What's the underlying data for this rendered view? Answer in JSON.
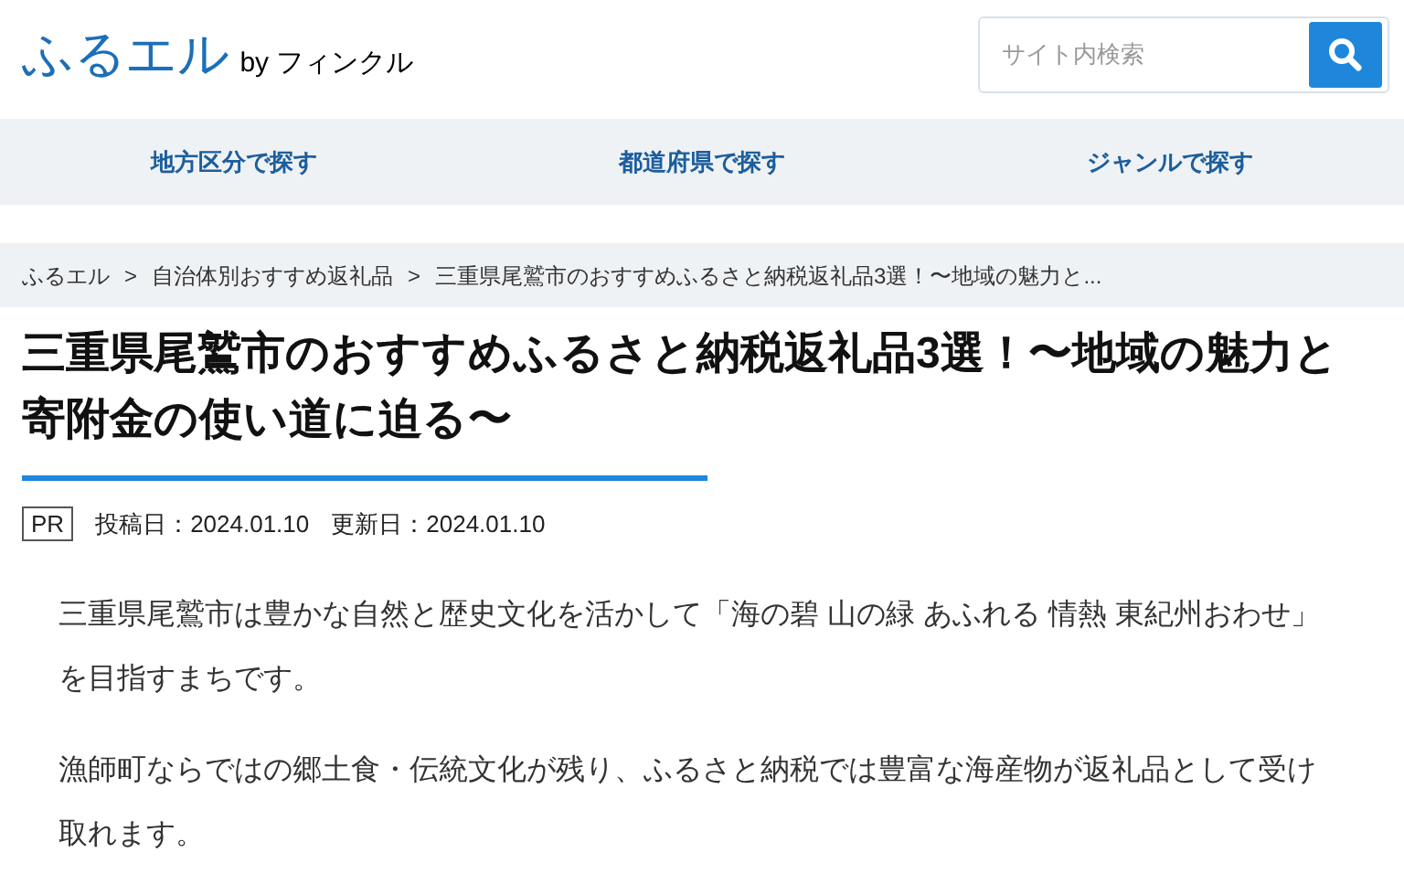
{
  "header": {
    "logo": "ふるエル",
    "logo_sub": "by フィンクル",
    "search": {
      "placeholder": "サイト内検索"
    }
  },
  "nav": [
    "地方区分で探す",
    "都道府県で探す",
    "ジャンルで探す"
  ],
  "breadcrumb": [
    {
      "label": "ふるエル"
    },
    {
      "label": "自治体別おすすめ返礼品"
    },
    {
      "label": "三重県尾鷲市のおすすめふるさと納税返礼品3選！〜地域の魅力と..."
    }
  ],
  "breadcrumb_separator": ">",
  "article": {
    "title": "三重県尾鷲市のおすすめふるさと納税返礼品3選！〜地域の魅力と寄附金の使い道に迫る〜",
    "badge": "PR",
    "posted": "投稿日：2024.01.10",
    "updated": "更新日：2024.01.10",
    "paragraphs": [
      "三重県尾鷲市は豊かな自然と歴史文化を活かして「海の碧 山の緑 あふれる 情熱 東紀州おわせ」を目指すまちです。",
      "漁師町ならではの郷土食・伝統文化が残り、ふるさと納税では豊富な海産物が返礼品として受け取れます。"
    ]
  }
}
